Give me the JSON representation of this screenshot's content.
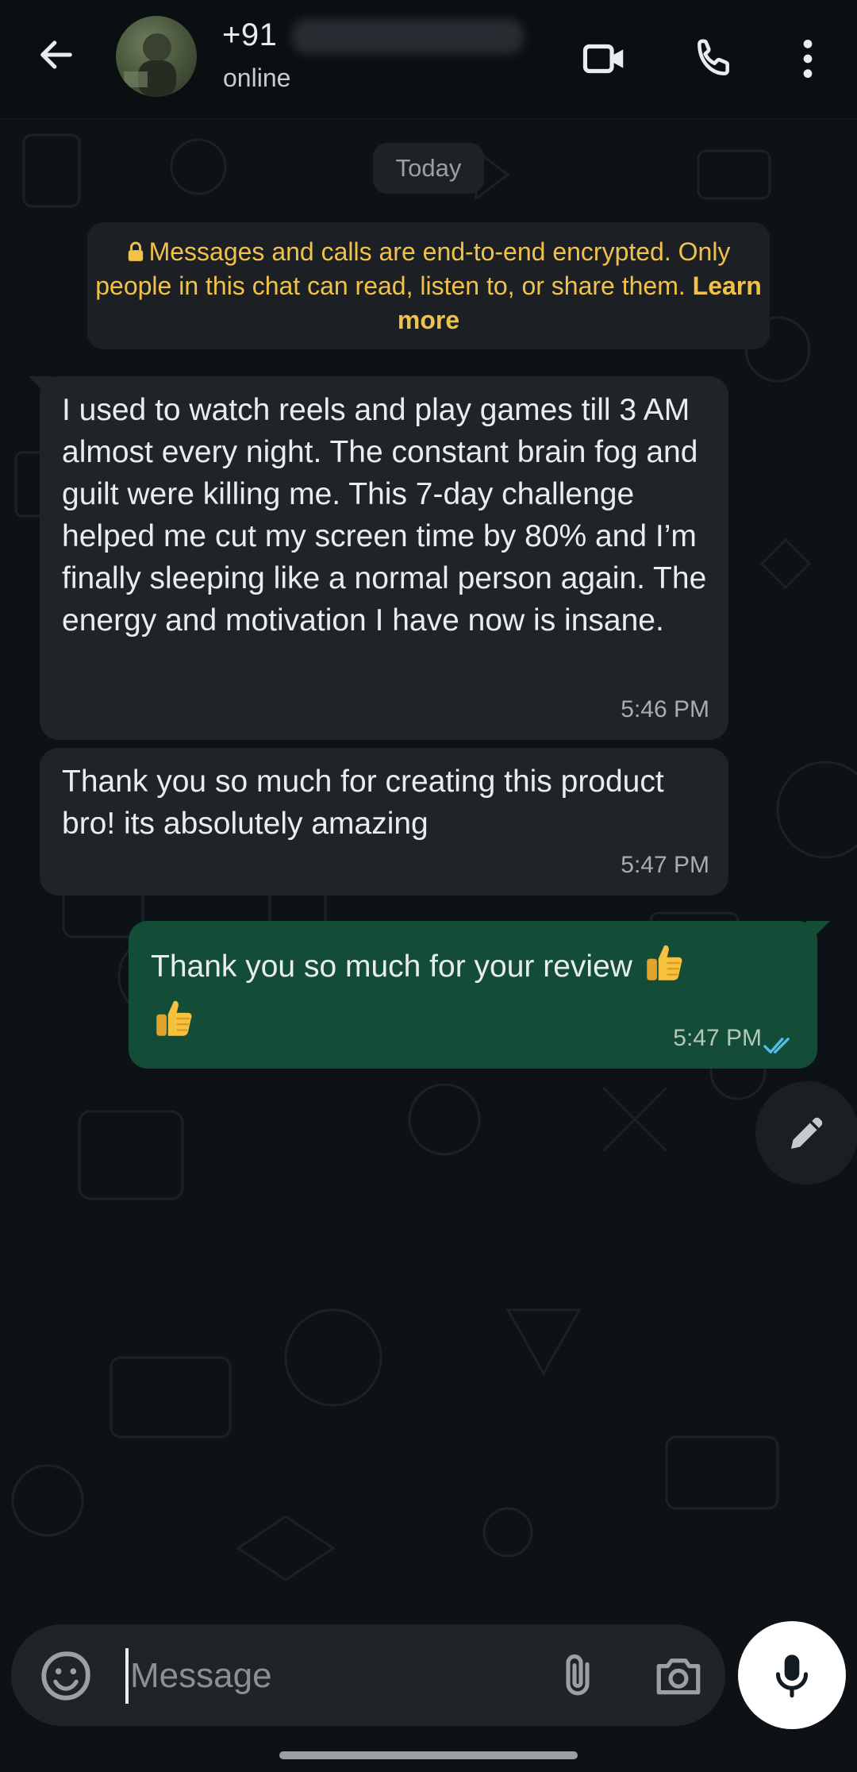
{
  "header": {
    "contact_name": "+91",
    "contact_status": "online",
    "icons": [
      "back-arrow-icon",
      "avatar",
      "video-call-icon",
      "voice-call-icon",
      "more-options-icon"
    ]
  },
  "chat": {
    "date_label": "Today",
    "encryption_notice": {
      "text": "Messages and calls are end-to-end encrypted. Only people in this chat can read, listen to, or share them.",
      "link": "Learn more",
      "icon": "lock-icon"
    },
    "messages": [
      {
        "direction": "incoming",
        "text": "I used to watch reels and play games till 3 AM almost every night. The constant brain fog and guilt were killing me. This 7-day challenge helped me cut my screen time by 80% and I’m finally sleeping like a normal person again. The energy and motivation I have now is insane.",
        "time": "5:46 PM"
      },
      {
        "direction": "incoming",
        "text": "Thank you so much for creating this product bro! its absolutely amazing",
        "time": "5:47 PM"
      },
      {
        "direction": "outgoing",
        "text": "Thank you so much for your review",
        "emojis": [
          "thumbs-up-emoji",
          "thumbs-up-emoji"
        ],
        "time": "5:47 PM",
        "status": "read"
      }
    ]
  },
  "composer": {
    "placeholder": "Message",
    "value": "",
    "icons": [
      "sticker-icon",
      "attach-icon",
      "camera-icon",
      "mic-icon"
    ]
  },
  "colors": {
    "background": "#0b141a",
    "incoming_bubble": "#1f2428",
    "outgoing_bubble": "#144d37",
    "encryption_text": "#f0c24a",
    "read_ticks": "#53bdeb"
  }
}
